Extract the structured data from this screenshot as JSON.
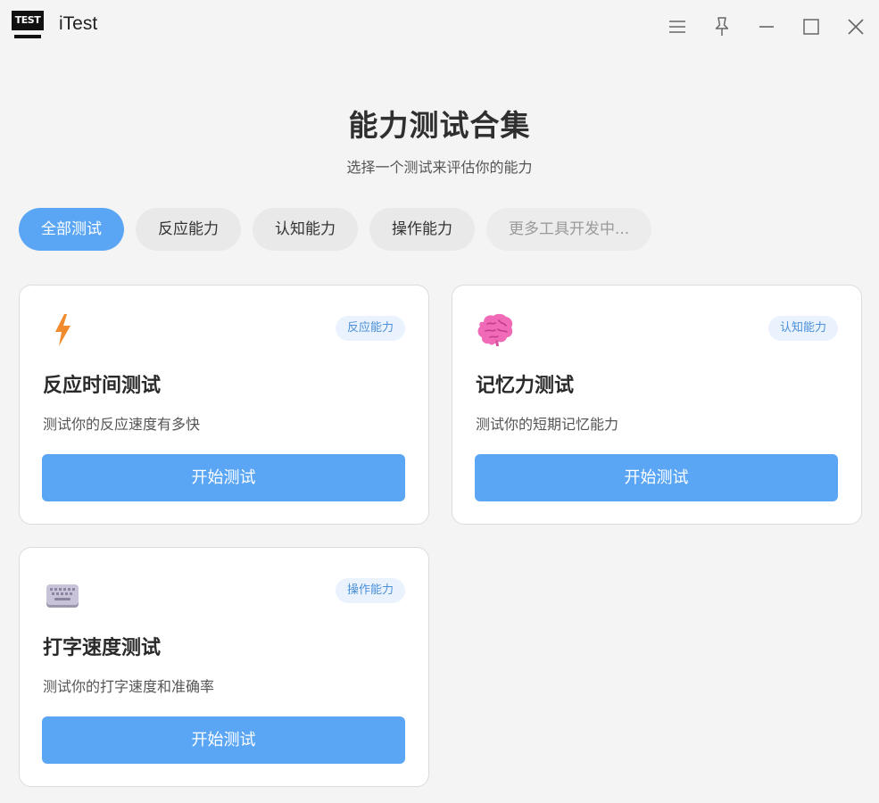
{
  "window": {
    "logo_text": "TEST",
    "title": "iTest",
    "controls": [
      "menu-icon",
      "pin-icon",
      "minimize-icon",
      "maximize-icon",
      "close-icon"
    ]
  },
  "header": {
    "title": "能力测试合集",
    "subtitle": "选择一个测试来评估你的能力"
  },
  "tabs": [
    {
      "label": "全部测试",
      "state": "active"
    },
    {
      "label": "反应能力",
      "state": "normal"
    },
    {
      "label": "认知能力",
      "state": "normal"
    },
    {
      "label": "操作能力",
      "state": "normal"
    },
    {
      "label": "更多工具开发中...",
      "state": "disabled"
    }
  ],
  "cards": [
    {
      "icon": "lightning-icon",
      "badge": "反应能力",
      "title": "反应时间测试",
      "description": "测试你的反应速度有多快",
      "button": "开始测试"
    },
    {
      "icon": "brain-icon",
      "badge": "认知能力",
      "title": "记忆力测试",
      "description": "测试你的短期记忆能力",
      "button": "开始测试"
    },
    {
      "icon": "keyboard-icon",
      "badge": "操作能力",
      "title": "打字速度测试",
      "description": "测试你的打字速度和准确率",
      "button": "开始测试"
    }
  ],
  "colors": {
    "accent": "#5aa6f4",
    "badge_bg": "#eaf3fd",
    "badge_text": "#4a8fd8",
    "background": "#f4f4f4",
    "lightning": "#f28a2e",
    "brain": "#f06ab8"
  }
}
